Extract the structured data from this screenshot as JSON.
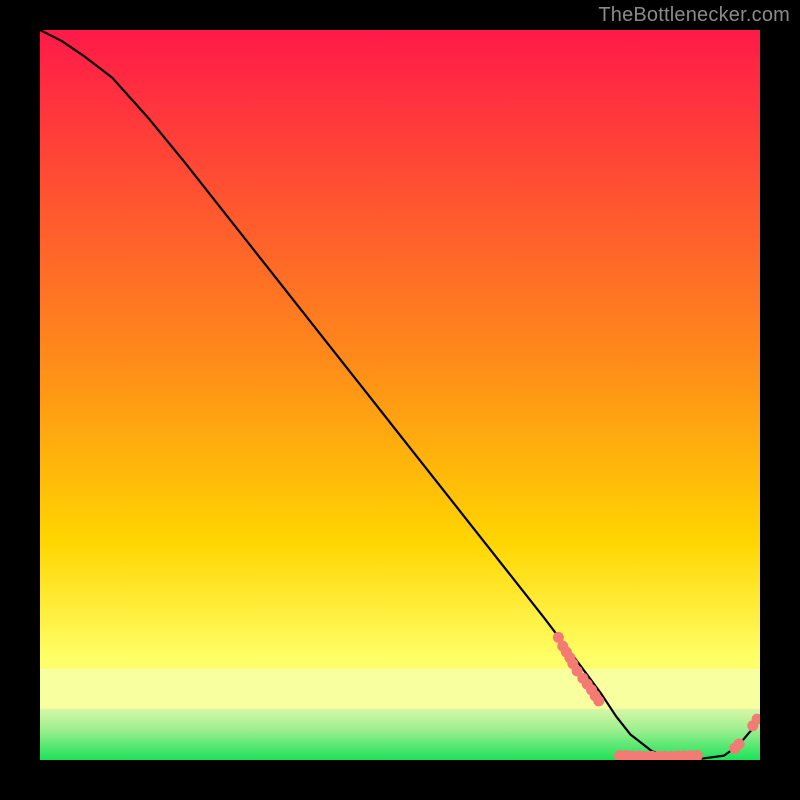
{
  "attribution": "TheBottlenecker.com",
  "chart_data": {
    "type": "line",
    "title": "",
    "xlabel": "",
    "ylabel": "",
    "xlim": [
      0,
      100
    ],
    "ylim": [
      0,
      100
    ],
    "background_gradient": {
      "top": "#ff1a48",
      "mid": "#ffd500",
      "low_pale": "#f7ff9e",
      "band_light_green": "#9eef8f",
      "bottom": "#1de25a"
    },
    "series": [
      {
        "name": "bottleneck-curve",
        "x": [
          0,
          3,
          6,
          10,
          15,
          20,
          30,
          40,
          50,
          60,
          70,
          75,
          78,
          80,
          82,
          85,
          88,
          90,
          92,
          95,
          97,
          100
        ],
        "y": [
          100,
          98.5,
          96.5,
          93.5,
          88.0,
          82.0,
          69.5,
          57.0,
          44.5,
          32.0,
          19.5,
          13.0,
          9.0,
          6.0,
          3.5,
          1.2,
          0.3,
          0.2,
          0.2,
          0.6,
          2.0,
          5.5
        ]
      }
    ],
    "marker_clusters": [
      {
        "name": "scatter-cluster-left",
        "points": [
          [
            72,
            16.8
          ],
          [
            72.6,
            15.6
          ],
          [
            73.1,
            14.8
          ],
          [
            73.6,
            14.0
          ],
          [
            74.0,
            13.2
          ],
          [
            74.6,
            12.2
          ],
          [
            75.4,
            11.2
          ],
          [
            76.0,
            10.4
          ],
          [
            76.6,
            9.6
          ],
          [
            77.1,
            8.8
          ],
          [
            77.6,
            8.1
          ]
        ]
      },
      {
        "name": "scatter-cluster-bottom",
        "points": [
          [
            80.5,
            0.6
          ],
          [
            81.4,
            0.6
          ],
          [
            82.3,
            0.55
          ],
          [
            83.2,
            0.55
          ],
          [
            84.1,
            0.5
          ],
          [
            85.0,
            0.5
          ],
          [
            85.9,
            0.5
          ],
          [
            86.8,
            0.5
          ],
          [
            87.7,
            0.5
          ],
          [
            88.6,
            0.55
          ],
          [
            89.5,
            0.55
          ],
          [
            90.4,
            0.6
          ],
          [
            91.3,
            0.6
          ]
        ]
      },
      {
        "name": "scatter-cluster-right",
        "points": [
          [
            96.5,
            1.6
          ],
          [
            97.1,
            2.2
          ],
          [
            99.0,
            4.7
          ],
          [
            99.6,
            5.6
          ]
        ]
      }
    ],
    "marker_color": "#f47b74",
    "curve_color": "#000000"
  }
}
